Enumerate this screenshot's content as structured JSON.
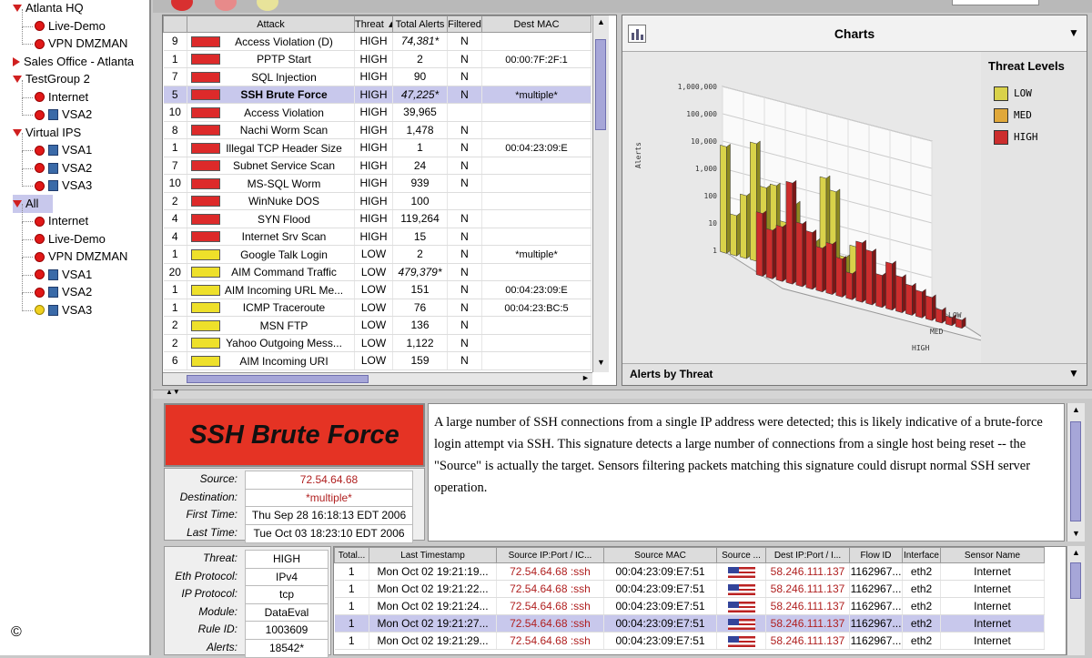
{
  "sidebar": {
    "items": [
      {
        "label": "Atlanta HQ",
        "kind": "group-open"
      },
      {
        "label": "Live-Demo",
        "kind": "dot-red"
      },
      {
        "label": "VPN DMZMAN",
        "kind": "dot-red"
      },
      {
        "label": "Sales Office - Atlanta",
        "kind": "group-closed"
      },
      {
        "label": "TestGroup 2",
        "kind": "group-open"
      },
      {
        "label": "Internet",
        "kind": "dot-red"
      },
      {
        "label": "VSA2",
        "kind": "vsa-red"
      },
      {
        "label": "Virtual IPS",
        "kind": "group-open"
      },
      {
        "label": "VSA1",
        "kind": "vsa-red"
      },
      {
        "label": "VSA2",
        "kind": "vsa-red"
      },
      {
        "label": "VSA3",
        "kind": "vsa-red"
      },
      {
        "label": "All",
        "kind": "group-open-selected"
      },
      {
        "label": "Internet",
        "kind": "dot-red"
      },
      {
        "label": "Live-Demo",
        "kind": "dot-red"
      },
      {
        "label": "VPN DMZMAN",
        "kind": "dot-red"
      },
      {
        "label": "VSA1",
        "kind": "vsa-red"
      },
      {
        "label": "VSA2",
        "kind": "vsa-red"
      },
      {
        "label": "VSA3",
        "kind": "vsa-yellow"
      }
    ],
    "copyright_mark": "©"
  },
  "threat_table": {
    "columns": [
      "",
      "Attack",
      "Threat ▲",
      "Total Alerts",
      "Filtered",
      "Dest MAC"
    ],
    "rows": [
      {
        "count": "9",
        "level": "high",
        "attack": "Access Violation (D)",
        "threat": "HIGH",
        "total": "74,381*",
        "filtered": "N",
        "dest_mac": ""
      },
      {
        "count": "1",
        "level": "high",
        "attack": "PPTP Start",
        "threat": "HIGH",
        "total": "2",
        "filtered": "N",
        "dest_mac": "00:00:7F:2F:1"
      },
      {
        "count": "7",
        "level": "high",
        "attack": "SQL Injection",
        "threat": "HIGH",
        "total": "90",
        "filtered": "N",
        "dest_mac": ""
      },
      {
        "count": "5",
        "level": "high",
        "attack": "SSH Brute Force",
        "threat": "HIGH",
        "total": "47,225*",
        "filtered": "N",
        "dest_mac": "*multiple*",
        "selected": true
      },
      {
        "count": "10",
        "level": "high",
        "attack": "Access Violation",
        "threat": "HIGH",
        "total": "39,965",
        "filtered": "",
        "dest_mac": ""
      },
      {
        "count": "8",
        "level": "high",
        "attack": "Nachi Worm Scan",
        "threat": "HIGH",
        "total": "1,478",
        "filtered": "N",
        "dest_mac": ""
      },
      {
        "count": "1",
        "level": "high",
        "attack": "Illegal TCP Header Size",
        "threat": "HIGH",
        "total": "1",
        "filtered": "N",
        "dest_mac": "00:04:23:09:E"
      },
      {
        "count": "7",
        "level": "high",
        "attack": "Subnet Service Scan",
        "threat": "HIGH",
        "total": "24",
        "filtered": "N",
        "dest_mac": ""
      },
      {
        "count": "10",
        "level": "high",
        "attack": "MS-SQL Worm",
        "threat": "HIGH",
        "total": "939",
        "filtered": "N",
        "dest_mac": ""
      },
      {
        "count": "2",
        "level": "high",
        "attack": "WinNuke DOS",
        "threat": "HIGH",
        "total": "100",
        "filtered": "",
        "dest_mac": ""
      },
      {
        "count": "4",
        "level": "high",
        "attack": "SYN Flood",
        "threat": "HIGH",
        "total": "119,264",
        "filtered": "N",
        "dest_mac": ""
      },
      {
        "count": "4",
        "level": "high",
        "attack": "Internet Srv Scan",
        "threat": "HIGH",
        "total": "15",
        "filtered": "N",
        "dest_mac": ""
      },
      {
        "count": "1",
        "level": "low",
        "attack": "Google Talk Login",
        "threat": "LOW",
        "total": "2",
        "filtered": "N",
        "dest_mac": "*multiple*"
      },
      {
        "count": "20",
        "level": "low",
        "attack": "AIM Command Traffic",
        "threat": "LOW",
        "total": "479,379*",
        "filtered": "N",
        "dest_mac": ""
      },
      {
        "count": "1",
        "level": "low",
        "attack": "AIM Incoming URL Me...",
        "threat": "LOW",
        "total": "151",
        "filtered": "N",
        "dest_mac": "00:04:23:09:E"
      },
      {
        "count": "1",
        "level": "low",
        "attack": "ICMP Traceroute",
        "threat": "LOW",
        "total": "76",
        "filtered": "N",
        "dest_mac": "00:04:23:BC:5"
      },
      {
        "count": "2",
        "level": "low",
        "attack": "MSN FTP",
        "threat": "LOW",
        "total": "136",
        "filtered": "N",
        "dest_mac": ""
      },
      {
        "count": "2",
        "level": "low",
        "attack": "Yahoo Outgoing Mess...",
        "threat": "LOW",
        "total": "1,122",
        "filtered": "N",
        "dest_mac": ""
      },
      {
        "count": "6",
        "level": "low",
        "attack": "AIM Incoming URI",
        "threat": "LOW",
        "total": "159",
        "filtered": "N",
        "dest_mac": ""
      }
    ]
  },
  "charts_panel": {
    "title": "Charts",
    "legend_title": "Threat Levels",
    "footer_label": "Alerts by Threat",
    "legend": [
      {
        "name": "LOW",
        "color": "#d9d24a"
      },
      {
        "name": "MED",
        "color": "#e0a83a"
      },
      {
        "name": "HIGH",
        "color": "#cc2d2d"
      }
    ],
    "y_axis_label": "Alerts",
    "y_ticks": [
      "1,000,000",
      "100,000",
      "10,000",
      "1,000",
      "100",
      "10",
      "1"
    ],
    "depth_labels": [
      "LOW",
      "MED",
      "HIGH"
    ]
  },
  "chart_data": {
    "type": "bar",
    "title": "",
    "ylabel": "Alerts",
    "y_scale": "log",
    "ylim": [
      1,
      1000000
    ],
    "series": [
      {
        "name": "LOW",
        "values": [
          8000,
          30,
          200,
          20000,
          600,
          900,
          50,
          300,
          4,
          20,
          5000,
          2000,
          10,
          30,
          8,
          3,
          1,
          2,
          1,
          1,
          1
        ]
      },
      {
        "name": "MED",
        "values": [
          1,
          1,
          1,
          1,
          1,
          1,
          1,
          1,
          1,
          1,
          1,
          1,
          1,
          1,
          1,
          1,
          1,
          1,
          1,
          1,
          1
        ]
      },
      {
        "name": "HIGH",
        "values": [
          200,
          60,
          100,
          5000,
          200,
          120,
          40,
          70,
          25,
          9,
          150,
          90,
          15,
          50,
          20,
          12,
          9,
          7,
          3,
          2,
          2
        ]
      }
    ]
  },
  "detail": {
    "title": "SSH Brute Force",
    "fields": [
      {
        "key": "Source:",
        "value": "72.54.64.68",
        "red": true
      },
      {
        "key": "Destination:",
        "value": "*multiple*",
        "red": true
      },
      {
        "key": "First Time:",
        "value": "Thu Sep 28 16:18:13 EDT 2006",
        "red": false
      },
      {
        "key": "Last Time:",
        "value": "Tue Oct 03 18:23:10 EDT 2006",
        "red": false
      }
    ],
    "description": "A large number of SSH connections from a single IP address were detected; this is likely indicative of a brute-force login attempt via SSH. This signature detects a large number of connections from a single host being reset -- the \"Source\" is actually the target. Sensors filtering packets matching this signature could disrupt normal SSH server operation."
  },
  "bottom_info": [
    {
      "key": "Threat:",
      "value": "HIGH"
    },
    {
      "key": "Eth Protocol:",
      "value": "IPv4"
    },
    {
      "key": "IP Protocol:",
      "value": "tcp"
    },
    {
      "key": "Module:",
      "value": "DataEval"
    },
    {
      "key": "Rule ID:",
      "value": "1003609"
    },
    {
      "key": "Alerts:",
      "value": "18542*"
    }
  ],
  "alert_table": {
    "columns": [
      "Total...",
      "Last Timestamp",
      "Source IP:Port / IC...",
      "Source MAC",
      "Source ...",
      "Dest IP:Port / I...",
      "Flow ID",
      "Interface",
      "Sensor Name"
    ],
    "rows": [
      {
        "total": "1",
        "ts": "Mon Oct 02 19:21:19...",
        "src": "72.54.64.68 :ssh",
        "mac": "00:04:23:09:E7:51",
        "dst": "58.246.111.137",
        "flow": "1162967...",
        "iface": "eth2",
        "sensor": "Internet"
      },
      {
        "total": "1",
        "ts": "Mon Oct 02 19:21:22...",
        "src": "72.54.64.68 :ssh",
        "mac": "00:04:23:09:E7:51",
        "dst": "58.246.111.137",
        "flow": "1162967...",
        "iface": "eth2",
        "sensor": "Internet"
      },
      {
        "total": "1",
        "ts": "Mon Oct 02 19:21:24...",
        "src": "72.54.64.68 :ssh",
        "mac": "00:04:23:09:E7:51",
        "dst": "58.246.111.137",
        "flow": "1162967...",
        "iface": "eth2",
        "sensor": "Internet"
      },
      {
        "total": "1",
        "ts": "Mon Oct 02 19:21:27...",
        "src": "72.54.64.68 :ssh",
        "mac": "00:04:23:09:E7:51",
        "dst": "58.246.111.137",
        "flow": "1162967...",
        "iface": "eth2",
        "sensor": "Internet",
        "selected": true
      },
      {
        "total": "1",
        "ts": "Mon Oct 02 19:21:29...",
        "src": "72.54.64.68 :ssh",
        "mac": "00:04:23:09:E7:51",
        "dst": "58.246.111.137",
        "flow": "1162967...",
        "iface": "eth2",
        "sensor": "Internet"
      }
    ]
  }
}
